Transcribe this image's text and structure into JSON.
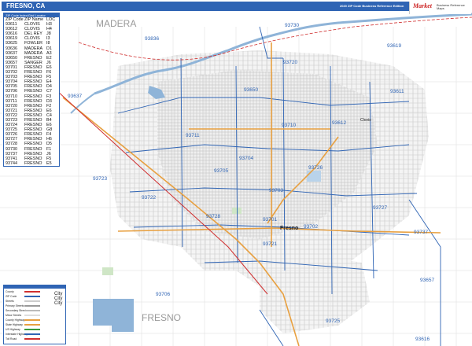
{
  "header": {
    "title": "FRESNO, CA",
    "edition": "2020 ZIP Code Business Reference Edition",
    "logo_text": "Market",
    "logo_sub": "Business Reference Maps"
  },
  "zip_table": {
    "heading": "ZIP Code Index/Grid Locator",
    "columns": [
      "ZIP Code",
      "ZIP Name",
      "LOC"
    ],
    "rows": [
      [
        "93611",
        "CLOVIS",
        "H3"
      ],
      [
        "93612",
        "CLOVIS",
        "H4"
      ],
      [
        "93616",
        "DEL REY",
        "J8"
      ],
      [
        "93619",
        "CLOVIS",
        "I3"
      ],
      [
        "93625",
        "FOWLER",
        "I8"
      ],
      [
        "93636",
        "MADERA",
        "D1"
      ],
      [
        "93637",
        "MADERA",
        "A3"
      ],
      [
        "93650",
        "FRESNO",
        "E2"
      ],
      [
        "93657",
        "SANGER",
        "J6"
      ],
      [
        "93701",
        "FRESNO",
        "E6"
      ],
      [
        "93702",
        "FRESNO",
        "F6"
      ],
      [
        "93703",
        "FRESNO",
        "F5"
      ],
      [
        "93704",
        "FRESNO",
        "E4"
      ],
      [
        "93705",
        "FRESNO",
        "D4"
      ],
      [
        "93706",
        "FRESNO",
        "C7"
      ],
      [
        "93710",
        "FRESNO",
        "F3"
      ],
      [
        "93711",
        "FRESNO",
        "D3"
      ],
      [
        "93720",
        "FRESNO",
        "F2"
      ],
      [
        "93721",
        "FRESNO",
        "E6"
      ],
      [
        "93722",
        "FRESNO",
        "C4"
      ],
      [
        "93723",
        "FRESNO",
        "B4"
      ],
      [
        "93724",
        "FRESNO",
        "E6"
      ],
      [
        "93725",
        "FRESNO",
        "G8"
      ],
      [
        "93726",
        "FRESNO",
        "F4"
      ],
      [
        "93727",
        "FRESNO",
        "H6"
      ],
      [
        "93728",
        "FRESNO",
        "D5"
      ],
      [
        "93730",
        "FRESNO",
        "F1"
      ],
      [
        "93737",
        "FRESNO",
        "J6"
      ],
      [
        "93741",
        "FRESNO",
        "F5"
      ],
      [
        "93744",
        "FRESNO",
        "E5"
      ]
    ]
  },
  "map_labels": {
    "county_north": "MADERA",
    "county_south": "FRESNO",
    "city_fresno": "Fresno",
    "city_clovis": "Clovis",
    "zips": [
      {
        "code": "93730"
      },
      {
        "code": "93836"
      },
      {
        "code": "93619"
      },
      {
        "code": "93720"
      },
      {
        "code": "93637"
      },
      {
        "code": "93650"
      },
      {
        "code": "93611"
      },
      {
        "code": "93710"
      },
      {
        "code": "93612"
      },
      {
        "code": "93711"
      },
      {
        "code": "93704"
      },
      {
        "code": "93705"
      },
      {
        "code": "93726"
      },
      {
        "code": "93723"
      },
      {
        "code": "93703"
      },
      {
        "code": "93722"
      },
      {
        "code": "93727"
      },
      {
        "code": "93728"
      },
      {
        "code": "93701"
      },
      {
        "code": "93702"
      },
      {
        "code": "93737"
      },
      {
        "code": "93721"
      },
      {
        "code": "93657"
      },
      {
        "code": "93706"
      },
      {
        "code": "93725"
      },
      {
        "code": "93616"
      }
    ]
  },
  "legend": {
    "items": [
      "County",
      "ZIP Code",
      "Streets",
      "Primary Streets",
      "Secondary Streets",
      "Minor Streets",
      "County Highway",
      "State Highway",
      "US Highway",
      "Interstate Highway",
      "Toll Road"
    ],
    "big_labels": [
      "City",
      "City",
      "City"
    ],
    "colors": {
      "blue": "#2f64b4",
      "orange": "#e8a040",
      "red": "#d03030",
      "green": "#3a9a3a"
    }
  }
}
